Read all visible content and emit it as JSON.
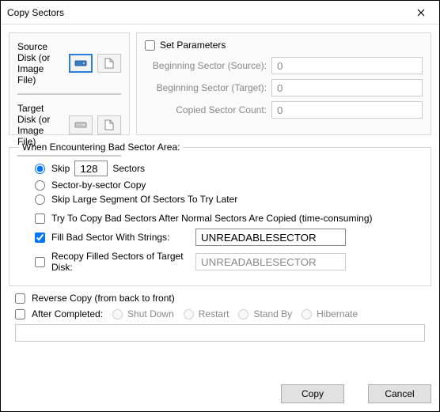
{
  "window": {
    "title": "Copy Sectors"
  },
  "disks": {
    "source_label": "Source Disk (or Image File)",
    "target_label": "Target Disk (or Image File)"
  },
  "params": {
    "heading": "Set Parameters",
    "begin_source_label": "Beginning Sector (Source):",
    "begin_source_value": "0",
    "begin_target_label": "Beginning Sector (Target):",
    "begin_target_value": "0",
    "copied_count_label": "Copied Sector Count:",
    "copied_count_value": "0"
  },
  "bad": {
    "legend": "When Encountering Bad Sector Area:",
    "skip_label_a": "Skip",
    "skip_count": "128",
    "skip_label_b": "Sectors",
    "sector_by_sector": "Sector-by-sector Copy",
    "skip_large": "Skip Large Segment Of Sectors To Try Later",
    "try_after": "Try To Copy Bad Sectors After Normal Sectors Are Copied (time-consuming)",
    "fill_label": "Fill Bad Sector With Strings:",
    "fill_value": "UNREADABLESECTOR",
    "recopy_label": "Recopy Filled Sectors of Target Disk:",
    "recopy_value": "UNREADABLESECTOR"
  },
  "reverse": "Reverse Copy (from back to front)",
  "after": {
    "label": "After Completed:",
    "shutdown": "Shut Down",
    "restart": "Restart",
    "standby": "Stand By",
    "hibernate": "Hibernate"
  },
  "buttons": {
    "copy": "Copy",
    "cancel": "Cancel"
  }
}
